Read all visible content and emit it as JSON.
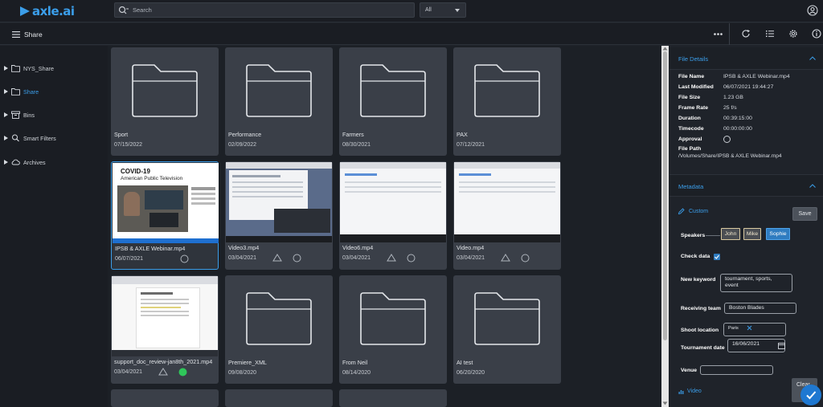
{
  "app": {
    "logo_text": "axle.ai",
    "brand_color": "#3b9eea"
  },
  "search": {
    "placeholder": "Search",
    "filter_value": "All"
  },
  "subbar": {
    "title": "Share"
  },
  "sidebar": {
    "items": [
      {
        "label": "NYS_Share",
        "icon": "folder-icon"
      },
      {
        "label": "Share",
        "icon": "folder-icon",
        "active": true
      },
      {
        "label": "Bins",
        "icon": "bin-icon"
      },
      {
        "label": "Smart Filters",
        "icon": "search-icon"
      },
      {
        "label": "Archives",
        "icon": "cloud-icon"
      }
    ]
  },
  "grid": {
    "items": [
      {
        "type": "folder",
        "name": "Sport",
        "date": "07/15/2022"
      },
      {
        "type": "folder",
        "name": "Performance",
        "date": "02/09/2022"
      },
      {
        "type": "folder",
        "name": "Farmers",
        "date": "08/30/2021"
      },
      {
        "type": "folder",
        "name": "PAX",
        "date": "07/12/2021"
      },
      {
        "type": "video",
        "name": "IPSB & AXLE Webinar.mp4",
        "date": "06/07/2021",
        "selected": true,
        "thumb_title": "COVID-19",
        "thumb_subtitle": "American Public Television"
      },
      {
        "type": "video",
        "name": "Video3.mp4",
        "date": "03/04/2021"
      },
      {
        "type": "video",
        "name": "Video6.mp4",
        "date": "03/04/2021"
      },
      {
        "type": "video",
        "name": "Video.mp4",
        "date": "03/04/2021"
      },
      {
        "type": "video",
        "name": "support_doc_review-jan8th_2021.mp4",
        "date": "03/04/2021",
        "approved": true
      },
      {
        "type": "folder",
        "name": "Premiere_XML",
        "date": "09/08/2020"
      },
      {
        "type": "folder",
        "name": "From Neil",
        "date": "08/14/2020"
      },
      {
        "type": "folder",
        "name": "AI test",
        "date": "06/20/2020"
      }
    ]
  },
  "file_details": {
    "section_title": "File Details",
    "file_name_label": "File Name",
    "file_name": "IPSB & AXLE Webinar.mp4",
    "last_modified_label": "Last Modified",
    "last_modified": "06/07/2021 19:44:27",
    "file_size_label": "File Size",
    "file_size": "1.23 GB",
    "frame_rate_label": "Frame Rate",
    "frame_rate": "25 f/s",
    "duration_label": "Duration",
    "duration": "00:39:15:00",
    "timecode_label": "Timecode",
    "timecode": "00:00:00:00",
    "approval_label": "Approval",
    "file_path_label": "File Path",
    "file_path": "/Volumes/Share/IPSB & AXLE Webinar.mp4"
  },
  "metadata": {
    "section_title": "Metadata",
    "custom_label": "Custom",
    "save_label": "Save",
    "speakers_label": "Speakers",
    "speakers": [
      {
        "name": "John",
        "selected": false
      },
      {
        "name": "Mike",
        "selected": false
      },
      {
        "name": "Sophie",
        "selected": true
      }
    ],
    "check_data_label": "Check data",
    "new_keyword_label": "New keyword",
    "new_keyword_line1": "tournament, sports,",
    "new_keyword_line2": "event",
    "receiving_team_label": "Receiving team",
    "receiving_team": "Boston Blades",
    "shoot_location_label": "Shoot location",
    "shoot_location": "Paris",
    "tournament_date_label": "Tournament date",
    "tournament_date": "16/06/2021",
    "venue_label": "Venue",
    "video_label": "Video",
    "clear_label": "Clear"
  }
}
